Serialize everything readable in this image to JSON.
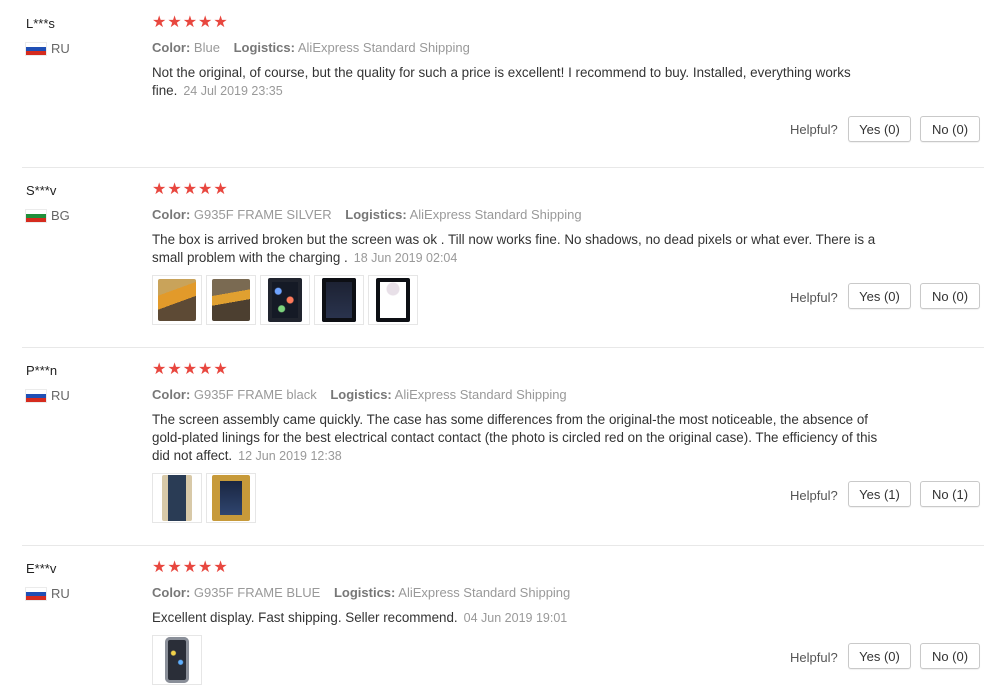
{
  "helpful_label": "Helpful?",
  "meta_labels": {
    "color": "Color:",
    "logistics": "Logistics:"
  },
  "reviews": [
    {
      "user": "L***s",
      "country": "RU",
      "stars": "★★★★★",
      "color": "Blue",
      "logistics": "AliExpress Standard Shipping",
      "text": "Not the original, of course, but the quality for such a price is excellent! I recommend to buy. Installed, everything works fine.",
      "date": "24 Jul 2019 23:35",
      "yes": "Yes (0)",
      "no": "No (0)",
      "photos": []
    },
    {
      "user": "S***v",
      "country": "BG",
      "stars": "★★★★★",
      "color": "G935F FRAME SILVER",
      "logistics": "AliExpress Standard Shipping",
      "text": "The box is arrived broken but the screen was ok . Till now works fine. No shadows, no dead pixels or what ever. There is a small problem with the charging .",
      "date": "18 Jun 2019 02:04",
      "yes": "Yes (0)",
      "no": "No (0)",
      "photos": [
        "box-photo",
        "box-photo",
        "phone-photo",
        "phone-photo",
        "phone-photo"
      ]
    },
    {
      "user": "P***n",
      "country": "RU",
      "stars": "★★★★★",
      "color": "G935F FRAME black",
      "logistics": "AliExpress Standard Shipping",
      "text": "The screen assembly came quickly. The case has some differences from the original-the most noticeable, the absence of gold-plated linings for the best electrical contact contact (the photo is circled red on the original case). The efficiency of this did not affect.",
      "date": "12 Jun 2019 12:38",
      "yes": "Yes (1)",
      "no": "No (1)",
      "photos": [
        "phone-photo",
        "phone-photo"
      ]
    },
    {
      "user": "E***v",
      "country": "RU",
      "stars": "★★★★★",
      "color": "G935F FRAME BLUE",
      "logistics": "AliExpress Standard Shipping",
      "text": "Excellent display. Fast shipping. Seller recommend.",
      "date": "04 Jun 2019 19:01",
      "yes": "Yes (0)",
      "no": "No (0)",
      "photos": [
        "phone-photo"
      ]
    }
  ]
}
